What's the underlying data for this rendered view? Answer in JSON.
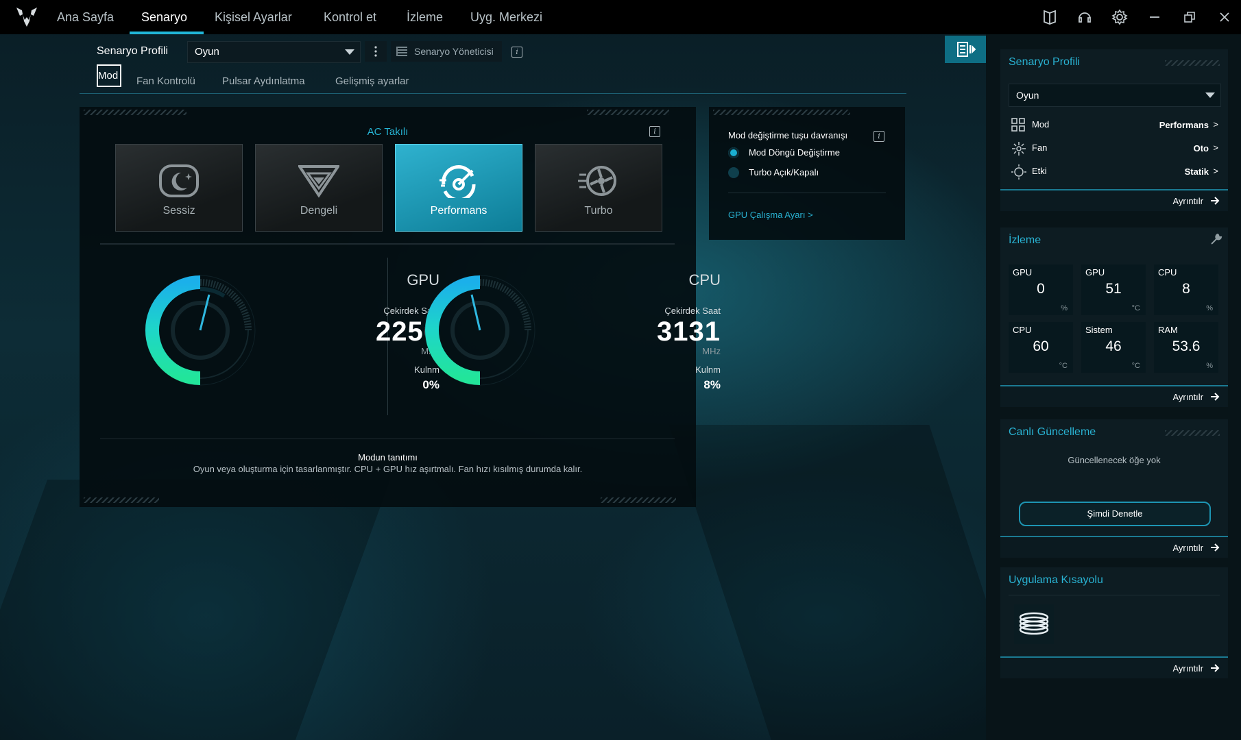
{
  "nav": {
    "tabs": [
      "Ana Sayfa",
      "Senaryo",
      "Kişisel Ayarlar",
      "Kontrol et",
      "İzleme",
      "Uyg. Merkezi"
    ],
    "active": "Senaryo"
  },
  "scenario": {
    "profile_label": "Senaryo Profili",
    "profile_value": "Oyun",
    "manager_label": "Senaryo Yöneticisi",
    "subtabs": [
      "Mod",
      "Fan Kontrolü",
      "Pulsar Aydınlatma",
      "Gelişmiş ayarlar"
    ],
    "active_subtab": "Mod"
  },
  "mode_panel": {
    "power_label": "AC Takılı",
    "modes": [
      {
        "name": "Sessiz",
        "icon": "quiet-mode-icon"
      },
      {
        "name": "Dengeli",
        "icon": "balanced-mode-icon"
      },
      {
        "name": "Performans",
        "icon": "performance-mode-icon"
      },
      {
        "name": "Turbo",
        "icon": "turbo-mode-icon"
      }
    ],
    "active_mode": "Performans",
    "accent_color": "#21b6d8",
    "gpu": {
      "title": "GPU",
      "clock_label": "Çekirdek Saat",
      "clock": "2250",
      "unit": "MHz",
      "usage_label": "Kulnm",
      "usage": "0%"
    },
    "cpu": {
      "title": "CPU",
      "clock_label": "Çekirdek Saat",
      "clock": "3131",
      "unit": "MHz",
      "usage_label": "Kulnm",
      "usage": "8%"
    },
    "desc_title": "Modun tanıtımı",
    "desc_text": "Oyun veya oluşturma için tasarlanmıştır. CPU + GPU hız aşırtmalı. Fan hızı kısılmış durumda kalır."
  },
  "toggle_panel": {
    "title": "Mod değiştirme tuşu davranışı",
    "options": [
      "Mod Döngü Değiştirme",
      "Turbo Açık/Kapalı"
    ],
    "selected": "Mod Döngü Değiştirme",
    "gpu_link": "GPU Çalışma Ayarı >"
  },
  "sidebar": {
    "profile_card": {
      "title": "Senaryo Profili",
      "value": "Oyun",
      "rows": [
        {
          "label": "Mod",
          "value": "Performans"
        },
        {
          "label": "Fan",
          "value": "Oto"
        },
        {
          "label": "Etki",
          "value": "Statik"
        }
      ],
      "footer": "Ayrıntılr"
    },
    "monitor_card": {
      "title": "İzleme",
      "tiles": [
        {
          "label": "GPU",
          "value": "0",
          "unit": "%"
        },
        {
          "label": "GPU",
          "value": "51",
          "unit": "°C"
        },
        {
          "label": "CPU",
          "value": "8",
          "unit": "%"
        },
        {
          "label": "CPU",
          "value": "60",
          "unit": "°C"
        },
        {
          "label": "Sistem",
          "value": "46",
          "unit": "°C"
        },
        {
          "label": "RAM",
          "value": "53.6",
          "unit": "%"
        }
      ],
      "footer": "Ayrıntılr"
    },
    "update_card": {
      "title": "Canlı Güncelleme",
      "status": "Güncellenecek öğe yok",
      "button": "Şimdi Denetle",
      "footer": "Ayrıntılr"
    },
    "shortcut_card": {
      "title": "Uygulama Kısayolu",
      "footer": "Ayrıntılr"
    }
  }
}
